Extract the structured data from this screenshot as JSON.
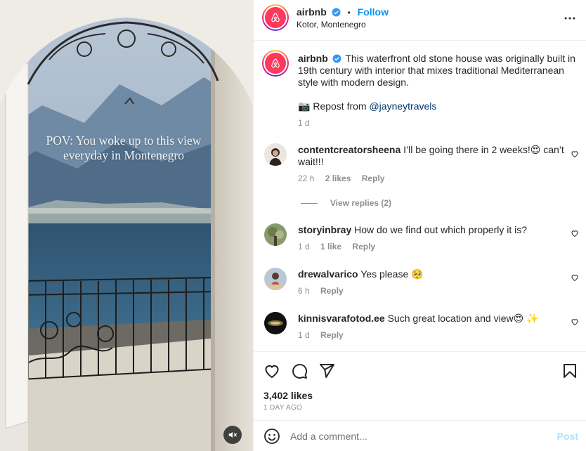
{
  "media": {
    "overlay_text": "POV: You woke up to this view everyday in Montenegro",
    "mute_icon": "speaker-muted-icon"
  },
  "header": {
    "username": "airbnb",
    "separator": "•",
    "follow_label": "Follow",
    "location": "Kotor, Montenegro",
    "more_icon": "ellipsis-icon"
  },
  "caption": {
    "username": "airbnb",
    "text": "This waterfront old stone house was originally built in 19th century with interior that mixes traditional Mediterranean style with modern design.",
    "repost_emoji": "📷",
    "repost_text": "Repost from",
    "repost_handle": "@jayneytravels",
    "time": "1 d"
  },
  "comments": [
    {
      "username": "contentcreatorsheena",
      "text": "I’ll be going there in 2 weeks!😍 can’t wait!!!",
      "time": "22 h",
      "likes": "2 likes",
      "reply": "Reply"
    },
    {
      "username": "storyinbray",
      "text": "How do we find out which properly it is?",
      "time": "1 d",
      "likes": "1 like",
      "reply": "Reply"
    },
    {
      "username": "drewalvarico",
      "text": "Yes please 🥺",
      "time": "6 h",
      "reply": "Reply"
    },
    {
      "username": "kinnisvarafotod.ee",
      "text": "Such great location and view😍 ✨",
      "time": "1 d",
      "reply": "Reply"
    }
  ],
  "view_replies": "View replies (2)",
  "actions": {
    "likes": "3,402 likes",
    "ago": "1 DAY AGO"
  },
  "add_comment": {
    "placeholder": "Add a comment...",
    "post_label": "Post"
  }
}
